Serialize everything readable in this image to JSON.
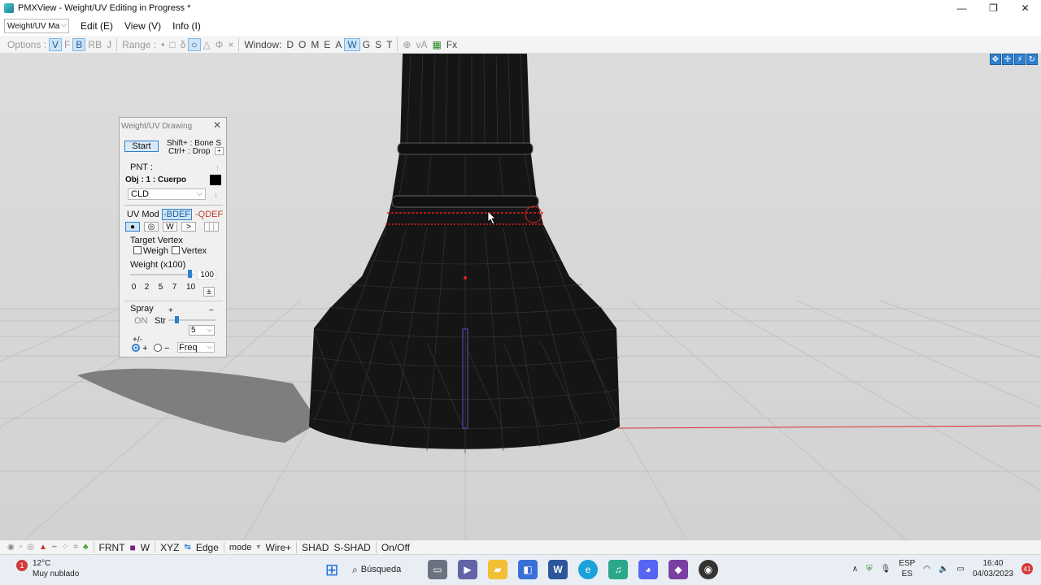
{
  "window": {
    "title": "PMXView - Weight/UV Editing in Progress *",
    "minimize_icon": "minimize-icon",
    "maximize_icon": "maximize-icon",
    "close_icon": "close-icon"
  },
  "menubar": {
    "mode_select": "Weight/UV Ma",
    "items": [
      "Edit (E)",
      "View (V)",
      "Info (I)"
    ]
  },
  "toolbar": {
    "options_label": "Options :",
    "options": [
      "V",
      "F",
      "B",
      "RB",
      "J"
    ],
    "range_label": "Range :",
    "range": [
      "•",
      "□",
      "δ",
      "○",
      "△",
      "Φ",
      "×"
    ],
    "window_label": "Window:",
    "window": [
      "D",
      "O",
      "M",
      "E",
      "A",
      "W",
      "G",
      "S",
      "T"
    ],
    "extra": [
      "⊕",
      "vA",
      "Fx"
    ]
  },
  "panel": {
    "title": "Weight/UV Drawing",
    "start": "Start",
    "hint1": "Shift+ : Bone S",
    "hint2": "Ctrl+ : Drop",
    "pnt": "PNT :",
    "obj": "Obj : 1 : Cuerpo",
    "cld": "CLD",
    "uv_mode": "UV Mod",
    "bdef": "-BDEF",
    "qdef": "-QDEF",
    "mode_buttons": [
      "●",
      "◎",
      "W",
      ">",
      "| |"
    ],
    "target_vertex": "Target Vertex",
    "weight_chk": "Weigh",
    "vertex_chk": "Vertex",
    "weight_label": "Weight (x100)",
    "weight_value": "100",
    "presets": [
      "0",
      "2",
      "5",
      "7",
      "10"
    ],
    "pm": "±",
    "spray": "Spray",
    "plus": "+",
    "minus": "−",
    "on": "ON",
    "str": "Str",
    "str_value": "5",
    "plusminus": "+/-",
    "radio_plus": "+",
    "radio_minus": "−",
    "freq": "Freq"
  },
  "bottombar": {
    "items": [
      "FRNT",
      "W",
      "XYZ",
      "Edge",
      "mode",
      "Wire+",
      "SHAD",
      "S-SHAD",
      "On/Off"
    ]
  },
  "taskbar": {
    "temp": "12°C",
    "weather": "Muy nublado",
    "weather_badge": "1",
    "search": "Búsqueda",
    "lang1": "ESP",
    "lang2": "ES",
    "time": "16:40",
    "date": "04/03/2023",
    "notifications": "41"
  },
  "colors": {
    "accent": "#2f7fcf",
    "selection_red": "#e02020",
    "mesh": "#1a1a1a",
    "floor": "#d9d9d9"
  }
}
